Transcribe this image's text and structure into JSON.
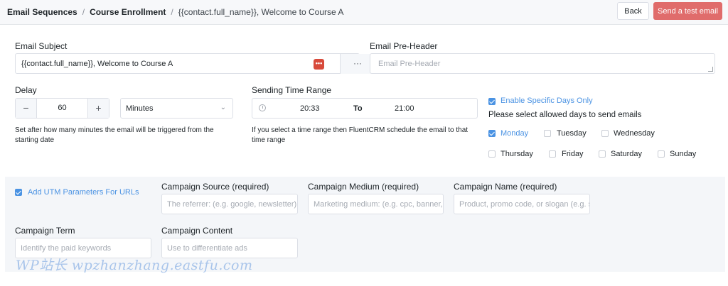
{
  "header": {
    "breadcrumb": [
      "Email Sequences",
      "Course Enrollment",
      "{{contact.full_name}}, Welcome to Course A"
    ],
    "separator": "/",
    "back_label": "Back",
    "test_label": "Send a test email"
  },
  "subject": {
    "label": "Email Subject",
    "value": "{{contact.full_name}}, Welcome to Course A",
    "dots": "•••"
  },
  "preheader": {
    "label": "Email Pre-Header",
    "placeholder": "Email Pre-Header"
  },
  "delay": {
    "label": "Delay",
    "minus": "−",
    "plus": "+",
    "value": "60",
    "unit": "Minutes",
    "help": "Set after how many minutes the email will be triggered from the starting date"
  },
  "time_range": {
    "label": "Sending Time Range",
    "start": "20:33",
    "to": "To",
    "end": "21:00",
    "help": "If you select a time range then FluentCRM schedule the email to that time range"
  },
  "days": {
    "enable_label": "Enable Specific Days Only",
    "enable_checked": true,
    "prompt": "Please select allowed days to send emails",
    "items": [
      {
        "label": "Monday",
        "checked": true
      },
      {
        "label": "Tuesday",
        "checked": false
      },
      {
        "label": "Wednesday",
        "checked": false
      },
      {
        "label": "Thursday",
        "checked": false
      },
      {
        "label": "Friday",
        "checked": false
      },
      {
        "label": "Saturday",
        "checked": false
      },
      {
        "label": "Sunday",
        "checked": false
      }
    ]
  },
  "utm": {
    "enable_label": "Add UTM Parameters For URLs",
    "enable_checked": true,
    "source_label": "Campaign Source (required)",
    "source_placeholder": "The referrer: (e.g. google, newsletter)",
    "medium_label": "Campaign Medium (required)",
    "medium_placeholder": "Marketing medium: (e.g. cpc, banner,",
    "name_label": "Campaign Name (required)",
    "name_placeholder": "Product, promo code, or slogan (e.g. s",
    "term_label": "Campaign Term",
    "term_placeholder": "Identify the paid keywords",
    "content_label": "Campaign Content",
    "content_placeholder": "Use to differentiate ads"
  },
  "watermark": "WP站长 wpzhanzhang.eastfu.com",
  "colors": {
    "accent": "#4b93e3",
    "danger_button": "#e06c6b",
    "merge_tag_badge": "#d84a3b",
    "panel_bg": "#f4f6f9"
  }
}
